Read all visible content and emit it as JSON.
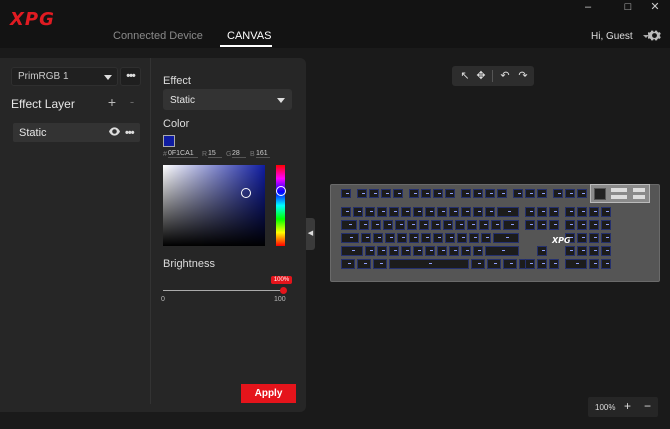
{
  "app": {
    "logo": "XPG"
  },
  "window_controls": {
    "minimize": "–",
    "maximize": "□",
    "close": "✕"
  },
  "nav": {
    "connected_device": "Connected Device",
    "canvas": "CANVAS"
  },
  "user": {
    "greeting": "Hi, Guest"
  },
  "layers": {
    "profile": "PrimRGB 1",
    "more": "•••",
    "title": "Effect Layer",
    "add": "+",
    "remove": "-",
    "items": [
      {
        "label": "Static",
        "more": "•••"
      }
    ]
  },
  "effect": {
    "label": "Effect",
    "value": "Static",
    "color_label": "Color",
    "swatch": "#0F1CA1",
    "hex_prefix": "#",
    "hex": "0F1CA1",
    "r_label": "R",
    "r": "15",
    "g_label": "G",
    "g": "28",
    "b_label": "B",
    "b": "161",
    "brightness_label": "Brightness",
    "brightness_value": 100,
    "brightness_badge": "100%",
    "brightness_min": "0",
    "brightness_max": "100",
    "apply": "Apply"
  },
  "toolbar": {
    "select": "↖",
    "move": "✥",
    "undo": "↶",
    "redo": "↷"
  },
  "keyboard": {
    "brand": "XPG",
    "key_color": "#0F1CA1"
  },
  "zoom": {
    "value": "100%",
    "in": "+",
    "out": "−"
  },
  "colors": {
    "accent": "#e5141b",
    "panel": "#262626",
    "background": "#1a1a1a"
  }
}
